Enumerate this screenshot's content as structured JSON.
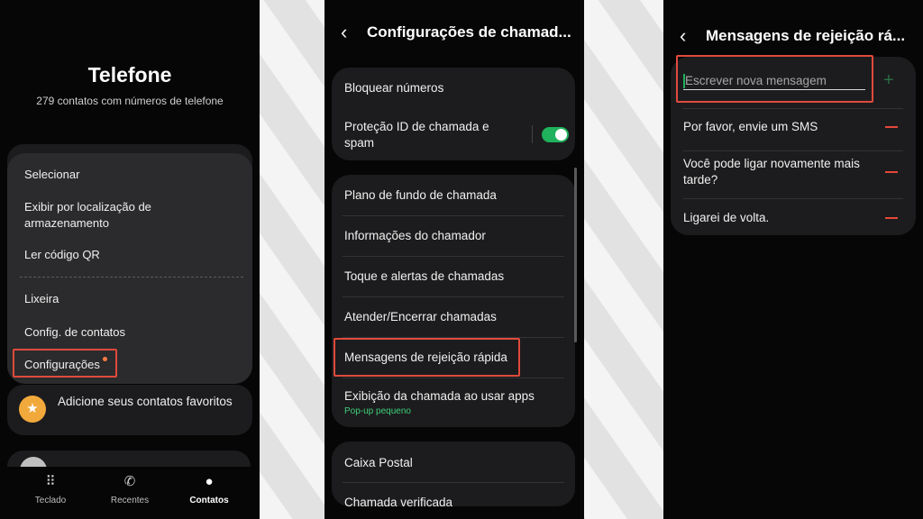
{
  "panel1": {
    "title": "Telefone",
    "subtitle": "279 contatos com números de telefone",
    "menu_items": [
      "Selecionar",
      "Exibir por localização de armazenamento",
      "Ler código QR",
      "Lixeira",
      "Config. de contatos",
      "Configurações"
    ],
    "favorites_text": "Adicione seus contatos favoritos",
    "favorites_icon": "star-icon",
    "bottom_nav": [
      "Teclado",
      "Recentes",
      "Contatos"
    ],
    "active_tab": "Contatos"
  },
  "panel2": {
    "title": "Configurações de chamad...",
    "card1": [
      "Bloquear números",
      "Proteção ID de chamada e spam"
    ],
    "toggle_on": true,
    "card2": [
      "Plano de fundo de chamada",
      "Informações do chamador",
      "Toque e alertas de chamadas",
      "Atender/Encerrar chamadas",
      "Mensagens de rejeição rápida",
      "Exibição da chamada ao usar apps"
    ],
    "card2_sub": "Pop-up pequeno",
    "card3": [
      "Caixa Postal",
      "Chamada verificada"
    ]
  },
  "panel3": {
    "title": "Mensagens de rejeição rá...",
    "input_placeholder": "Escrever nova mensagem",
    "messages": [
      "Por favor, envie um SMS",
      "Você pode ligar novamente mais tarde?",
      "Ligarei de volta."
    ]
  },
  "colors": {
    "accent_green": "#1fb15c",
    "highlight_red": "#e04a3c",
    "panel_bg": "#060606",
    "card_bg": "#1c1c1e"
  }
}
